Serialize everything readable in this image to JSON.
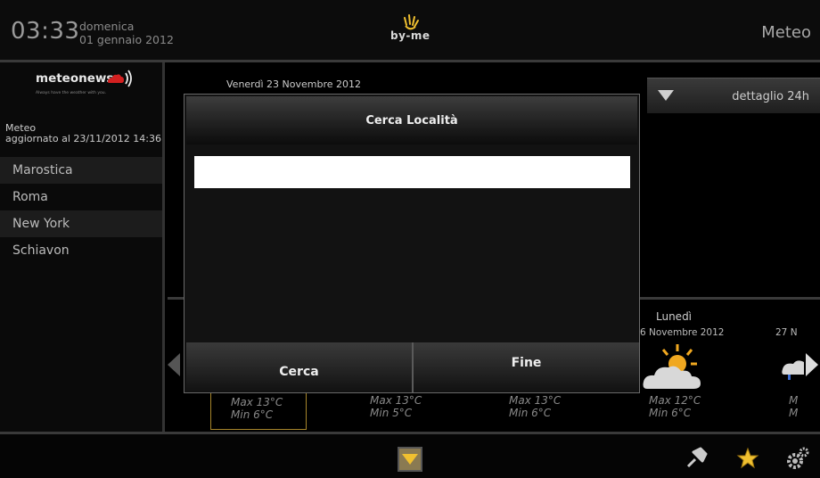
{
  "status_bar": {
    "time": "03:33",
    "weekday": "domenica",
    "date": "01 gennaio 2012",
    "brand": "by-me",
    "app_title": "Meteo"
  },
  "sidebar": {
    "logo_text": "meteonews",
    "logo_tagline": "Always have the weather with you.",
    "update_title": "Meteo",
    "update_text": "aggiornato al 23/11/2012 14:36",
    "locations": [
      {
        "label": "Marostica"
      },
      {
        "label": "Roma"
      },
      {
        "label": "New York"
      },
      {
        "label": "Schiavon"
      }
    ]
  },
  "main": {
    "current_date": "Venerdì 23 Novembre 2012",
    "detail_button": "dettaglio 24h",
    "days": [
      {
        "name": "Lunedì",
        "date": "6 Novembre 2012"
      },
      {
        "name": "",
        "date": "27 N"
      }
    ],
    "forecasts": [
      {
        "max": "Max 13°C",
        "min": "Min 6°C"
      },
      {
        "max": "Max 13°C",
        "min": "Min 5°C"
      },
      {
        "max": "Max 13°C",
        "min": "Min 6°C"
      },
      {
        "max": "Max 12°C",
        "min": "Min 6°C"
      },
      {
        "max": "M",
        "min": "M"
      }
    ]
  },
  "dialog": {
    "title": "Cerca Località",
    "search_value": "",
    "search_button": "Cerca",
    "done_button": "Fine"
  },
  "colors": {
    "accent": "#f0c030",
    "selection_border": "#a7862b",
    "background": "#000000"
  },
  "icons": {
    "brand": "hand-logo-icon",
    "weather": "partly-cloudy-icon",
    "pin": "pin-icon",
    "favorite": "star-icon",
    "settings": "gear-icon",
    "home": "home-chevron-icon"
  }
}
